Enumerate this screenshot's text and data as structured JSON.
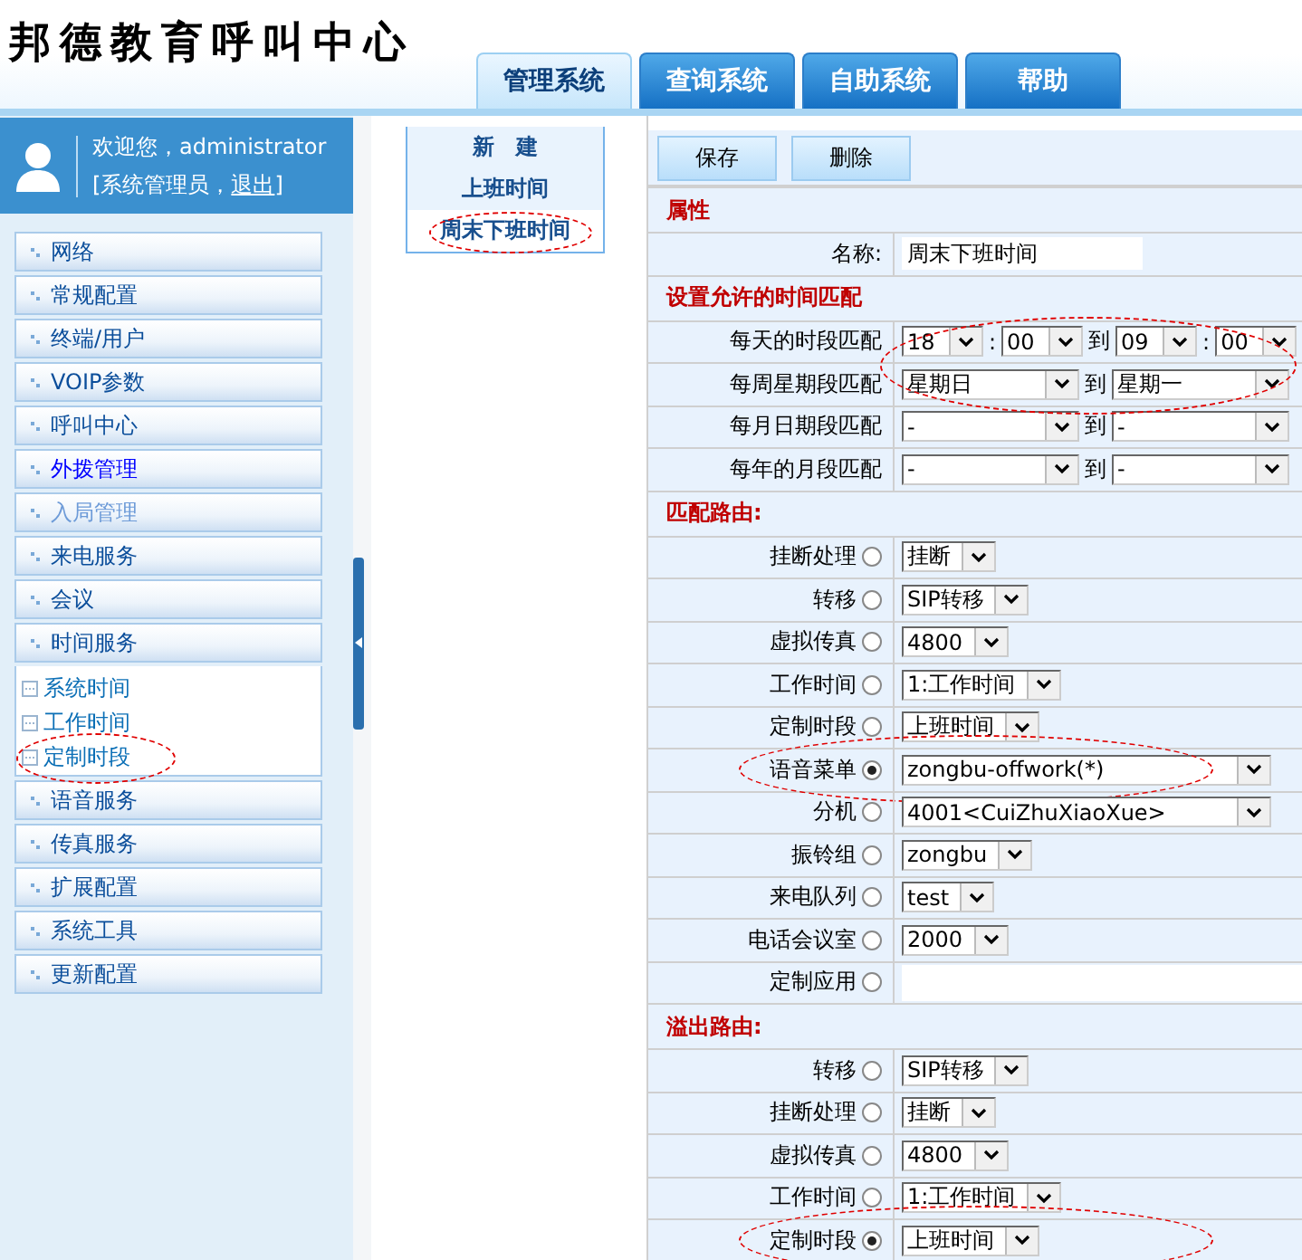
{
  "app_title": "邦德教育呼叫中心",
  "top_tabs": [
    {
      "label": "管理系统",
      "selected": true
    },
    {
      "label": "查询系统",
      "selected": false
    },
    {
      "label": "自助系统",
      "selected": false
    },
    {
      "label": "帮助",
      "selected": false
    }
  ],
  "user": {
    "greeting": "欢迎您，administrator",
    "role_prefix": "[系统管理员，",
    "logout": "退出",
    "role_suffix": "]"
  },
  "sidebar": {
    "items": [
      {
        "label": "网络",
        "highlighted": false,
        "disabled": false
      },
      {
        "label": "常规配置",
        "highlighted": false,
        "disabled": false
      },
      {
        "label": "终端/用户",
        "highlighted": false,
        "disabled": false
      },
      {
        "label": "VOIP参数",
        "highlighted": false,
        "disabled": false
      },
      {
        "label": "呼叫中心",
        "highlighted": false,
        "disabled": false
      },
      {
        "label": "外拨管理",
        "highlighted": true,
        "disabled": false
      },
      {
        "label": "入局管理",
        "highlighted": false,
        "disabled": true
      },
      {
        "label": "来电服务",
        "highlighted": false,
        "disabled": false
      },
      {
        "label": "会议",
        "highlighted": false,
        "disabled": false
      },
      {
        "label": "时间服务",
        "highlighted": false,
        "disabled": false,
        "children": [
          {
            "label": "系统时间",
            "circled": false
          },
          {
            "label": "工作时间",
            "circled": false
          },
          {
            "label": "定制时段",
            "circled": true
          }
        ]
      },
      {
        "label": "语音服务",
        "highlighted": false,
        "disabled": false
      },
      {
        "label": "传真服务",
        "highlighted": false,
        "disabled": false
      },
      {
        "label": "扩展配置",
        "highlighted": false,
        "disabled": false
      },
      {
        "label": "系统工具",
        "highlighted": false,
        "disabled": false
      },
      {
        "label": "更新配置",
        "highlighted": false,
        "disabled": false
      }
    ]
  },
  "record_list": {
    "items": [
      {
        "label": "新　建",
        "selected": false,
        "circled": false
      },
      {
        "label": "上班时间",
        "selected": false,
        "circled": false
      },
      {
        "label": "周末下班时间",
        "selected": true,
        "circled": true
      }
    ]
  },
  "form": {
    "buttons": [
      "保存",
      "删除"
    ],
    "properties": {
      "title": "属性",
      "name_label": "名称:",
      "name_value": "周末下班时间"
    },
    "time_match": {
      "title": "设置允许的时间匹配",
      "circled": true,
      "rows": [
        {
          "label": "每天的时段匹配",
          "kind": "time",
          "from": [
            "18",
            "00"
          ],
          "from_colon": ":",
          "separator": "到",
          "to": [
            "09",
            "00"
          ],
          "to_colon": ":"
        },
        {
          "label": "每周星期段匹配",
          "kind": "range",
          "from": [
            "星期日"
          ],
          "separator": "到",
          "to": [
            "星期一"
          ]
        },
        {
          "label": "每月日期段匹配",
          "kind": "range",
          "from": [
            "-"
          ],
          "separator": "到",
          "to": [
            "-"
          ]
        },
        {
          "label": "每年的月段匹配",
          "kind": "range",
          "from": [
            "-"
          ],
          "separator": "到",
          "to": [
            "-"
          ]
        }
      ]
    },
    "match_routes": {
      "title": "匹配路由:",
      "rows": [
        {
          "label": "挂断处理",
          "selected": false,
          "kind": "select",
          "value": "挂断",
          "circled": false
        },
        {
          "label": "转移",
          "selected": false,
          "kind": "select",
          "value": "SIP转移",
          "circled": false
        },
        {
          "label": "虚拟传真",
          "selected": false,
          "kind": "select",
          "value": "4800",
          "circled": false
        },
        {
          "label": "工作时间",
          "selected": false,
          "kind": "select",
          "value": "1:工作时间",
          "circled": false
        },
        {
          "label": "定制时段",
          "selected": false,
          "kind": "select",
          "value": "上班时间",
          "circled": false
        },
        {
          "label": "语音菜单",
          "selected": true,
          "kind": "select",
          "value": "zongbu-offwork(*)",
          "circled": true
        },
        {
          "label": "分机",
          "selected": false,
          "kind": "select",
          "value": "4001<CuiZhuXiaoXue>",
          "circled": false
        },
        {
          "label": "振铃组",
          "selected": false,
          "kind": "select",
          "value": "zongbu",
          "circled": false
        },
        {
          "label": "来电队列",
          "selected": false,
          "kind": "select",
          "value": "test",
          "circled": false
        },
        {
          "label": "电话会议室",
          "selected": false,
          "kind": "select",
          "value": "2000",
          "circled": false
        },
        {
          "label": "定制应用",
          "selected": false,
          "kind": "input",
          "circled": false
        }
      ]
    },
    "overflow_routes": {
      "title": "溢出路由:",
      "rows": [
        {
          "label": "转移",
          "selected": false,
          "kind": "select",
          "value": "SIP转移",
          "circled": false
        },
        {
          "label": "挂断处理",
          "selected": false,
          "kind": "select",
          "value": "挂断",
          "circled": false
        },
        {
          "label": "虚拟传真",
          "selected": false,
          "kind": "select",
          "value": "4800",
          "circled": false
        },
        {
          "label": "工作时间",
          "selected": false,
          "kind": "select",
          "value": "1:工作时间",
          "circled": false
        },
        {
          "label": "定制时段",
          "selected": true,
          "kind": "select",
          "value": "上班时间",
          "circled": true
        }
      ]
    }
  }
}
